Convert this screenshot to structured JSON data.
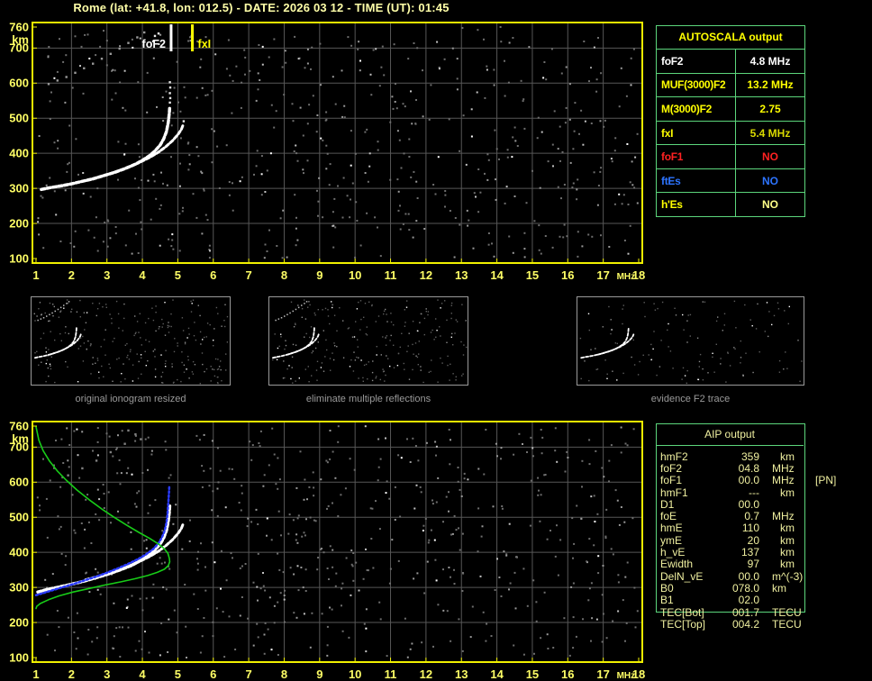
{
  "title": "Rome (lat: +41.8, lon: 012.5) - DATE: 2026 03 12 - TIME (UT): 01:45",
  "colors": {
    "background": "#000000",
    "plot_border": "#f0f000",
    "grid": "#575757",
    "axis_label": "#ffff66",
    "title_text": "#ffffa8",
    "table_border": "#5cd67c",
    "aip_text": "#f0f0a0",
    "trace_white": "#ffffff",
    "trace_blue": "#2a3bff",
    "profile_green": "#18cc18",
    "thumb_caption": "#9a9a9a"
  },
  "autoscala": {
    "header": "AUTOSCALA output",
    "header_color": "#ffff00",
    "rows": [
      {
        "label": "foF2",
        "value": "4.8 MHz",
        "label_color": "#ffffff",
        "value_color": "#ffffff"
      },
      {
        "label": "MUF(3000)F2",
        "value": "13.2 MHz",
        "label_color": "#ffff00",
        "value_color": "#ffff00"
      },
      {
        "label": "M(3000)F2",
        "value": "2.75",
        "label_color": "#ffff00",
        "value_color": "#ffff00"
      },
      {
        "label": "fxI",
        "value": "5.4 MHz",
        "label_color": "#ffff00",
        "value_color": "#d9d900"
      },
      {
        "label": "foF1",
        "value": "NO",
        "label_color": "#ff2222",
        "value_color": "#ff2222"
      },
      {
        "label": "ftEs",
        "value": "NO",
        "label_color": "#2d74ff",
        "value_color": "#2d74ff"
      },
      {
        "label": "h'Es",
        "value": "NO",
        "label_color": "#ffff00",
        "value_color": "#ffff88"
      }
    ]
  },
  "aip": {
    "header": "AIP output",
    "rows": [
      {
        "label": "hmF2",
        "value": "359",
        "unit": "km",
        "extra": ""
      },
      {
        "label": "foF2",
        "value": "04.8",
        "unit": "MHz",
        "extra": ""
      },
      {
        "label": "foF1",
        "value": "00.0",
        "unit": "MHz",
        "extra": "[PN]"
      },
      {
        "label": "hmF1",
        "value": "---",
        "unit": "km",
        "extra": ""
      },
      {
        "label": "D1",
        "value": "00.0",
        "unit": "",
        "extra": ""
      },
      {
        "label": "foE",
        "value": "0.7",
        "unit": "MHz",
        "extra": ""
      },
      {
        "label": "hmE",
        "value": "110",
        "unit": "km",
        "extra": ""
      },
      {
        "label": "ymE",
        "value": "20",
        "unit": "km",
        "extra": ""
      },
      {
        "label": "h_vE",
        "value": "137",
        "unit": "km",
        "extra": ""
      },
      {
        "label": "Ewidth",
        "value": "97",
        "unit": "km",
        "extra": ""
      },
      {
        "label": "DelN_vE",
        "value": "00.0",
        "unit": "m^(-3)",
        "extra": ""
      },
      {
        "label": "B0",
        "value": "078.0",
        "unit": "km",
        "extra": ""
      },
      {
        "label": "B1",
        "value": "02.0",
        "unit": "",
        "extra": ""
      },
      {
        "label": "TEC[Bot]",
        "value": "001.7",
        "unit": "TECU",
        "extra": ""
      },
      {
        "label": "TEC[Top]",
        "value": "004.2",
        "unit": "TECU",
        "extra": ""
      }
    ]
  },
  "thumbnails": [
    {
      "caption": "original ionogram resized"
    },
    {
      "caption": "eliminate multiple reflections"
    },
    {
      "caption": "evidence F2 trace"
    }
  ],
  "chart_data": [
    {
      "type": "scatter",
      "title": "scaled ionogram with AUTOSCALA markers",
      "xlabel": "MHz",
      "ylabel": "km",
      "xlim": [
        1,
        18
      ],
      "ylim": [
        100,
        760
      ],
      "grid": true,
      "x_ticks": [
        1,
        2,
        3,
        4,
        5,
        6,
        7,
        8,
        9,
        10,
        11,
        12,
        13,
        14,
        15,
        16,
        17,
        18
      ],
      "y_ticks": [
        760,
        700,
        600,
        500,
        400,
        300,
        200,
        100
      ],
      "markers": [
        {
          "name": "foF2",
          "x": 4.81,
          "label": "foF2",
          "color": "#ffffff",
          "label_side": "left"
        },
        {
          "name": "fxI",
          "x": 5.41,
          "label": "fxI",
          "color": "#ffff00",
          "label_side": "right"
        }
      ],
      "series": [
        {
          "name": "O-trace",
          "color": "#ffffff",
          "style": "blobs",
          "width": 3.5,
          "points": [
            [
              1.15,
              297
            ],
            [
              1.4,
              302
            ],
            [
              1.7,
              307
            ],
            [
              2.0,
              313
            ],
            [
              2.3,
              320
            ],
            [
              2.6,
              327
            ],
            [
              2.9,
              336
            ],
            [
              3.2,
              345
            ],
            [
              3.5,
              356
            ],
            [
              3.8,
              369
            ],
            [
              4.0,
              380
            ],
            [
              4.2,
              393
            ],
            [
              4.35,
              406
            ],
            [
              4.5,
              423
            ],
            [
              4.6,
              441
            ],
            [
              4.68,
              462
            ],
            [
              4.73,
              488
            ],
            [
              4.76,
              515
            ],
            [
              4.77,
              532
            ]
          ]
        },
        {
          "name": "X-trace",
          "color": "#ffffff",
          "style": "blobs",
          "width": 3,
          "points": [
            [
              2.4,
              322
            ],
            [
              2.7,
              330
            ],
            [
              3.0,
              339
            ],
            [
              3.3,
              349
            ],
            [
              3.6,
              360
            ],
            [
              3.9,
              373
            ],
            [
              4.2,
              388
            ],
            [
              4.45,
              403
            ],
            [
              4.65,
              418
            ],
            [
              4.85,
              436
            ],
            [
              5.0,
              453
            ],
            [
              5.1,
              468
            ],
            [
              5.15,
              481
            ]
          ]
        },
        {
          "name": "asymptote-spread",
          "color": "#e8e8e8",
          "style": "dots",
          "points": [
            [
              4.77,
              545
            ],
            [
              4.78,
              558
            ],
            [
              4.77,
              572
            ],
            [
              4.78,
              588
            ],
            [
              4.77,
              603
            ],
            [
              5.16,
              492
            ],
            [
              4.35,
              735
            ],
            [
              4.45,
              742
            ],
            [
              4.3,
              720
            ]
          ]
        },
        {
          "name": "second-hop-echo",
          "color": "#9a9a9a",
          "style": "dots",
          "points": [
            [
              1.35,
              598
            ],
            [
              1.6,
              608
            ],
            [
              1.85,
              618
            ],
            [
              2.1,
              630
            ],
            [
              2.35,
              643
            ],
            [
              2.6,
              656
            ],
            [
              2.85,
              670
            ],
            [
              3.1,
              684
            ],
            [
              3.35,
              699
            ],
            [
              3.6,
              715
            ],
            [
              3.85,
              731
            ],
            [
              4.05,
              745
            ]
          ]
        }
      ]
    },
    {
      "type": "scatter",
      "title": "ionogram with AIP model profile",
      "xlabel": "MHz",
      "ylabel": "km",
      "xlim": [
        1,
        18
      ],
      "ylim": [
        100,
        760
      ],
      "grid": true,
      "x_ticks": [
        1,
        2,
        3,
        4,
        5,
        6,
        7,
        8,
        9,
        10,
        11,
        12,
        13,
        14,
        15,
        16,
        17,
        18
      ],
      "y_ticks": [
        760,
        700,
        600,
        500,
        400,
        300,
        200,
        100
      ],
      "markers": [],
      "series": [
        {
          "name": "O-trace",
          "color": "#ffffff",
          "style": "blobs",
          "width": 3.5,
          "points": [
            [
              1.05,
              287
            ],
            [
              1.3,
              294
            ],
            [
              1.6,
              300
            ],
            [
              1.9,
              307
            ],
            [
              2.2,
              314
            ],
            [
              2.5,
              322
            ],
            [
              2.8,
              331
            ],
            [
              3.1,
              340
            ],
            [
              3.4,
              351
            ],
            [
              3.7,
              363
            ],
            [
              4.0,
              380
            ],
            [
              4.2,
              393
            ],
            [
              4.35,
              406
            ],
            [
              4.5,
              423
            ],
            [
              4.6,
              441
            ],
            [
              4.68,
              462
            ],
            [
              4.73,
              488
            ],
            [
              4.76,
              515
            ],
            [
              4.77,
              532
            ]
          ]
        },
        {
          "name": "X-trace",
          "color": "#ffffff",
          "style": "blobs",
          "width": 3,
          "points": [
            [
              2.4,
              322
            ],
            [
              2.7,
              330
            ],
            [
              3.0,
              339
            ],
            [
              3.3,
              349
            ],
            [
              3.6,
              360
            ],
            [
              3.9,
              373
            ],
            [
              4.2,
              388
            ],
            [
              4.45,
              403
            ],
            [
              4.65,
              418
            ],
            [
              4.85,
              436
            ],
            [
              5.0,
              453
            ],
            [
              5.1,
              468
            ],
            [
              5.15,
              481
            ]
          ]
        },
        {
          "name": "model-trace",
          "color": "#2a3bff",
          "style": "dotline",
          "width": 2.5,
          "points": [
            [
              1.0,
              278
            ],
            [
              1.2,
              284
            ],
            [
              1.5,
              293
            ],
            [
              1.8,
              302
            ],
            [
              2.1,
              311
            ],
            [
              2.4,
              321
            ],
            [
              2.7,
              331
            ],
            [
              3.0,
              342
            ],
            [
              3.3,
              354
            ],
            [
              3.6,
              367
            ],
            [
              3.9,
              382
            ],
            [
              4.1,
              394
            ],
            [
              4.3,
              409
            ],
            [
              4.45,
              425
            ],
            [
              4.55,
              442
            ],
            [
              4.63,
              462
            ],
            [
              4.68,
              485
            ],
            [
              4.71,
              510
            ],
            [
              4.73,
              540
            ],
            [
              4.75,
              570
            ],
            [
              4.76,
              592
            ]
          ]
        },
        {
          "name": "electron-density-profile",
          "color": "#18cc18",
          "style": "line",
          "width": 1.6,
          "points": [
            [
              1.0,
              758
            ],
            [
              1.08,
              720
            ],
            [
              1.2,
              690
            ],
            [
              1.38,
              660
            ],
            [
              1.6,
              632
            ],
            [
              1.85,
              606
            ],
            [
              2.15,
              578
            ],
            [
              2.5,
              550
            ],
            [
              2.85,
              524
            ],
            [
              3.2,
              500
            ],
            [
              3.55,
              478
            ],
            [
              3.9,
              457
            ],
            [
              4.2,
              440
            ],
            [
              4.45,
              424
            ],
            [
              4.62,
              410
            ],
            [
              4.72,
              397
            ],
            [
              4.76,
              383
            ],
            [
              4.77,
              373
            ],
            [
              4.73,
              362
            ],
            [
              4.62,
              352
            ],
            [
              4.42,
              343
            ],
            [
              4.15,
              334
            ],
            [
              3.8,
              325
            ],
            [
              3.4,
              316
            ],
            [
              2.95,
              307
            ],
            [
              2.5,
              297
            ],
            [
              2.05,
              287
            ],
            [
              1.65,
              276
            ],
            [
              1.35,
              265
            ],
            [
              1.12,
              254
            ],
            [
              1.02,
              246
            ],
            [
              1.0,
              240
            ]
          ]
        },
        {
          "name": "second-hop-echo",
          "color": "#808080",
          "style": "dots",
          "points": [
            [
              1.9,
              620
            ],
            [
              2.3,
              640
            ],
            [
              2.7,
              662
            ],
            [
              3.1,
              686
            ],
            [
              3.5,
              710
            ],
            [
              3.8,
              737
            ],
            [
              3.95,
              723
            ],
            [
              3.6,
              748
            ]
          ]
        }
      ]
    }
  ]
}
